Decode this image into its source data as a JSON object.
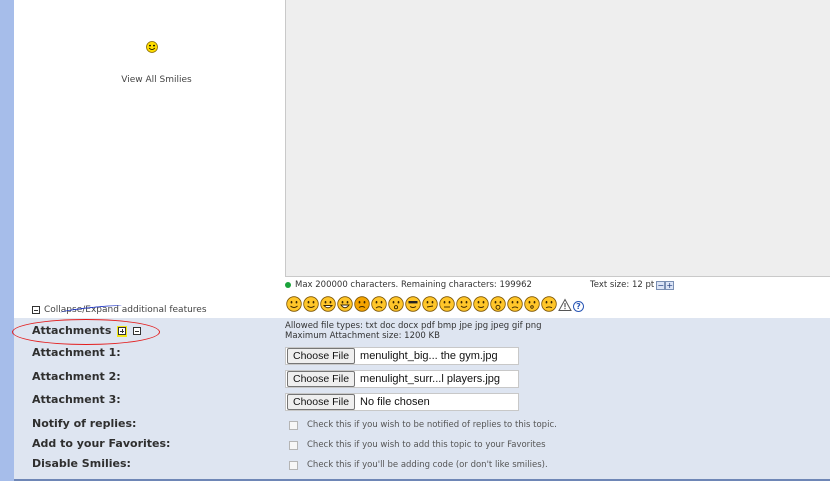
{
  "left_panel": {
    "view_all_smilies": "View All Smilies"
  },
  "editor": {
    "max_chars_text": "Max 200000 characters. Remaining characters: 199962",
    "text_size_label": "Text size: 12 pt",
    "decrease_label": "−",
    "increase_label": "+"
  },
  "collapse_expand_label": "Collapse/Expand additional features",
  "smilies": [
    "smile",
    "wink",
    "grin",
    "laugh",
    "angry",
    "sad",
    "surprised",
    "cool",
    "confused",
    "rolleyes",
    "tongue",
    "blush",
    "shocked",
    "cry",
    "eek",
    "unhappy"
  ],
  "attachments": {
    "label": "Attachments",
    "allowed_types": "Allowed file types: txt doc docx pdf bmp jpe jpg jpeg gif png",
    "max_size": "Maximum Attachment size: 1200 KB",
    "items": [
      {
        "label": "Attachment 1:",
        "button": "Choose File",
        "file": "menulight_big... the gym.jpg"
      },
      {
        "label": "Attachment 2:",
        "button": "Choose File",
        "file": "menulight_surr...l players.jpg"
      },
      {
        "label": "Attachment 3:",
        "button": "Choose File",
        "file": "No file chosen"
      }
    ]
  },
  "options": [
    {
      "label": "Notify of replies:",
      "text": "Check this if you wish to be notified of replies to this topic."
    },
    {
      "label": "Add to your Favorites:",
      "text": "Check this if you wish to add this topic to your Favorites"
    },
    {
      "label": "Disable Smilies:",
      "text": "Check this if you'll be adding code (or don't like smilies)."
    }
  ],
  "colors": {
    "side_bar": "#a6bdea",
    "form_panel": "#dee5f1",
    "annotation_red": "#e31e1e",
    "annotation_blue": "#1e35c9",
    "highlight_yellow": "#f3e61a"
  }
}
